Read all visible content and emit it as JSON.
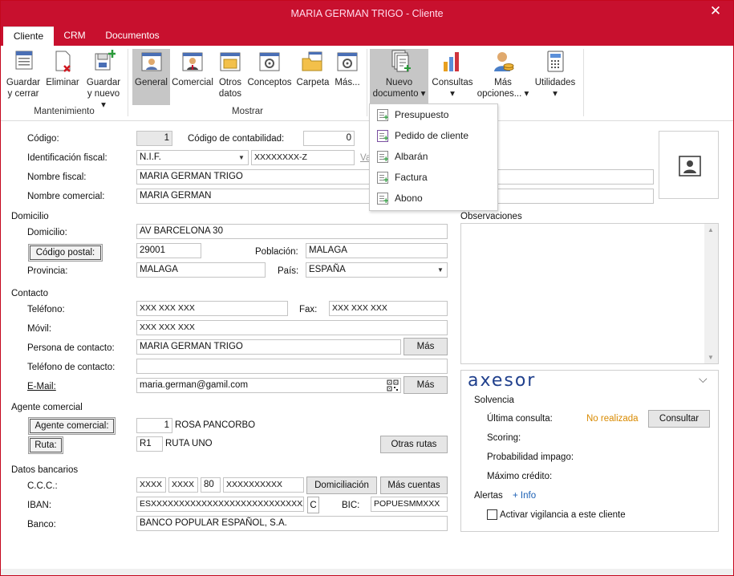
{
  "window": {
    "title": "MARIA GERMAN  TRIGO - Cliente",
    "close": "✕"
  },
  "tabs": [
    "Cliente",
    "CRM",
    "Documentos"
  ],
  "ribbon": {
    "buttons": [
      {
        "id": "guardar",
        "label1": "Guardar",
        "label2": "y cerrar"
      },
      {
        "id": "eliminar",
        "label1": "Eliminar",
        "label2": ""
      },
      {
        "id": "guardar_nuevo",
        "label1": "Guardar",
        "label2": "y nuevo ▾"
      },
      {
        "id": "general",
        "label1": "General",
        "label2": ""
      },
      {
        "id": "comercial",
        "label1": "Comercial",
        "label2": ""
      },
      {
        "id": "otros",
        "label1": "Otros",
        "label2": "datos"
      },
      {
        "id": "conceptos",
        "label1": "Conceptos",
        "label2": ""
      },
      {
        "id": "carpeta",
        "label1": "Carpeta",
        "label2": ""
      },
      {
        "id": "mas",
        "label1": "Más...",
        "label2": ""
      },
      {
        "id": "nuevo_doc",
        "label1": "Nuevo",
        "label2": "documento ▾"
      },
      {
        "id": "consultas",
        "label1": "Consultas",
        "label2": "▾"
      },
      {
        "id": "mas_opciones",
        "label1": "Más",
        "label2": "opciones... ▾"
      },
      {
        "id": "utilidades",
        "label1": "Utilidades",
        "label2": "▾"
      }
    ],
    "groups": {
      "mantenimiento": "Mantenimiento",
      "mostrar": "Mostrar"
    }
  },
  "menu": [
    "Presupuesto",
    "Pedido de cliente",
    "Albarán",
    "Factura",
    "Abono"
  ],
  "form": {
    "codigo_label": "Código:",
    "codigo": "1",
    "cod_contab_label": "Código de contabilidad:",
    "cod_contab": "0",
    "id_fiscal_label": "Identificación fiscal:",
    "id_fiscal_tipo": "N.I.F.",
    "id_fiscal": "XXXXXXXX-Z",
    "validar": "Va",
    "nombre_fiscal_label": "Nombre fiscal:",
    "nombre_fiscal": "MARIA GERMAN  TRIGO",
    "nombre_comercial_label": "Nombre comercial:",
    "nombre_comercial": "MARIA GERMAN",
    "domicilio_section": "Domicilio",
    "domicilio_label": "Domicilio:",
    "domicilio": "AV BARCELONA 30",
    "cp_button": "Código postal:",
    "cp": "29001",
    "poblacion_label": "Población:",
    "poblacion": "MALAGA",
    "provincia_label": "Provincia:",
    "provincia": "MALAGA",
    "pais_label": "País:",
    "pais": "ESPAÑA",
    "contacto_section": "Contacto",
    "telefono_label": "Teléfono:",
    "telefono": "XXX XXX XXX",
    "fax_label": "Fax:",
    "fax": "XXX XXX XXX",
    "movil_label": "Móvil:",
    "movil": "XXX XXX XXX",
    "persona_label": "Persona de contacto:",
    "persona": "MARIA GERMAN TRIGO",
    "mas": "Más",
    "tel_contacto_label": "Teléfono de contacto:",
    "tel_contacto": "",
    "email_label": "E-Mail:",
    "email": "maria.german@gamil.com",
    "agente_section": "Agente comercial",
    "agente_button": "Agente comercial:",
    "agente_num": "1",
    "agente_name": "ROSA PANCORBO",
    "ruta_button": "Ruta:",
    "ruta_code": "R1",
    "ruta_name": "RUTA UNO",
    "otras_rutas": "Otras rutas",
    "bancarios_section": "Datos bancarios",
    "ccc_label": "C.C.C.:",
    "ccc1": "XXXX",
    "ccc2": "XXXX",
    "ccc3": "80",
    "ccc4": "XXXXXXXXXX",
    "domiciliacion": "Domiciliación",
    "mas_cuentas": "Más cuentas",
    "iban_label": "IBAN:",
    "iban": "ESXXXXXXXXXXXXXXXXXXXXXXXXXXXXXXXXXXX",
    "iban_c": "C",
    "bic_label": "BIC:",
    "bic": "POPUESMMXXX",
    "banco_label": "Banco:",
    "banco": "BANCO POPULAR ESPAÑOL, S.A.",
    "observaciones_label": "Observaciones"
  },
  "axesor": {
    "logo": "axesor",
    "solvencia": "Solvencia",
    "ultima_label": "Última consulta:",
    "ultima": "No realizada",
    "consultar": "Consultar",
    "scoring": "Scoring:",
    "prob": "Probabilidad impago:",
    "maximo": "Máximo crédito:",
    "alertas": "Alertas",
    "info": "+ Info",
    "vigilancia": "Activar vigilancia a este cliente"
  },
  "colors": {
    "title_bar": "#c8102e",
    "warning": "#d98a00",
    "link": "#1a5fb4"
  }
}
